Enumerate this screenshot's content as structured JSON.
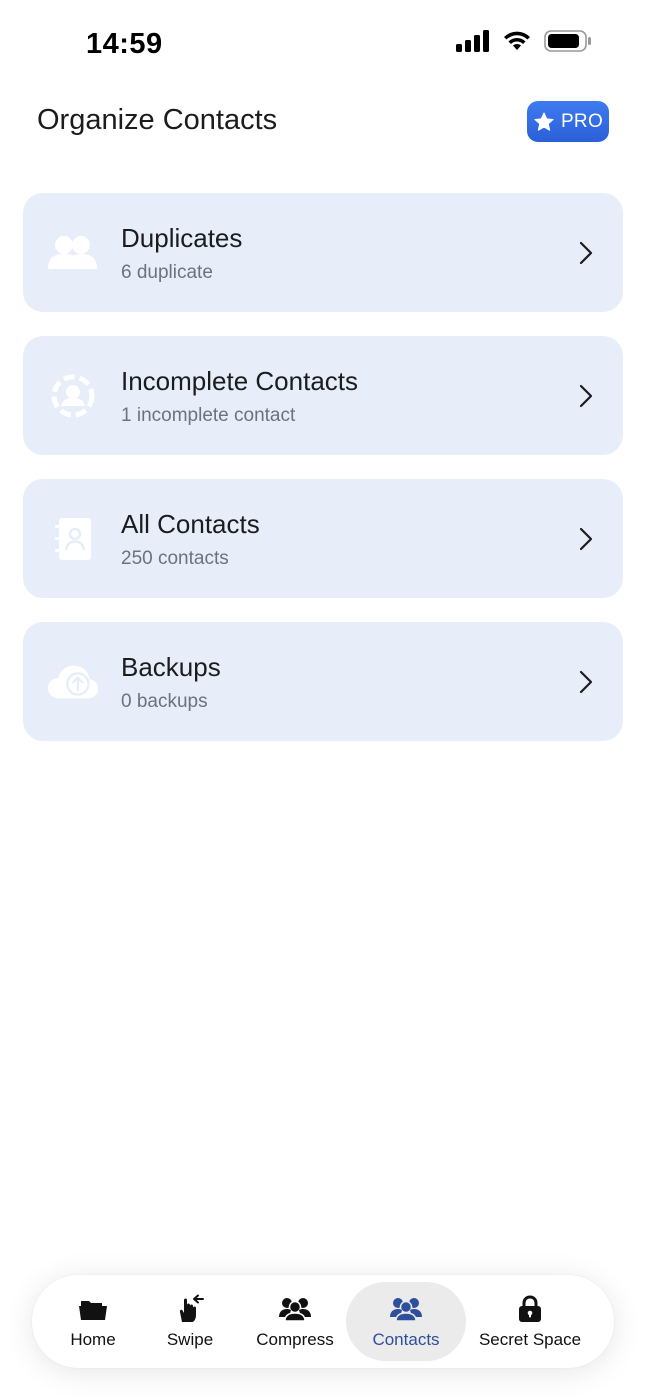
{
  "status_bar": {
    "time": "14:59"
  },
  "header": {
    "title": "Organize Contacts",
    "pro_label": "PRO"
  },
  "cards": [
    {
      "title": "Duplicates",
      "subtitle": "6 duplicate",
      "icon": "people-icon"
    },
    {
      "title": "Incomplete Contacts",
      "subtitle": "1 incomplete contact",
      "icon": "incomplete-contact-icon"
    },
    {
      "title": "All Contacts",
      "subtitle": "250 contacts",
      "icon": "address-book-icon"
    },
    {
      "title": "Backups",
      "subtitle": "0 backups",
      "icon": "cloud-upload-icon"
    }
  ],
  "tabbar": {
    "items": [
      {
        "label": "Home",
        "icon": "folder-icon"
      },
      {
        "label": "Swipe",
        "icon": "swipe-hand-icon"
      },
      {
        "label": "Compress",
        "icon": "people-icon"
      },
      {
        "label": "Contacts",
        "icon": "people-icon",
        "active": true
      },
      {
        "label": "Secret Space",
        "icon": "lock-icon"
      }
    ]
  },
  "colors": {
    "card_bg": "#e7eef9",
    "pro_badge": "#3f7bf0",
    "active_tab_label": "#2f4e9b"
  }
}
